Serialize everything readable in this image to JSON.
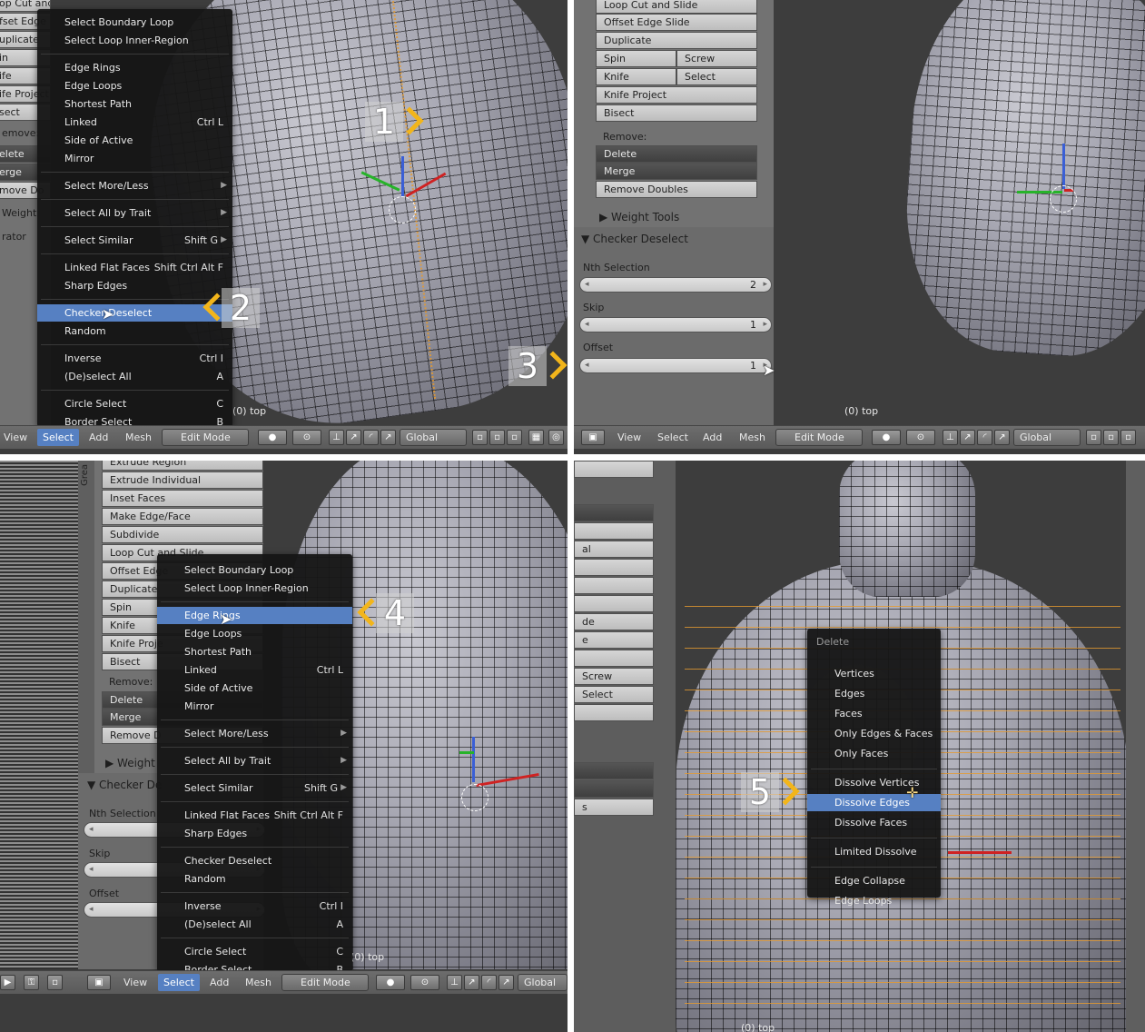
{
  "q1": {
    "left_panel_items": [
      "op Cut and Slide",
      "fset Edge",
      "uplicate",
      "in",
      "ife",
      "ife Project",
      "sect",
      "emove:",
      "elete",
      "erge",
      "move Do",
      "Weight",
      "rator"
    ],
    "menu": [
      {
        "label": "Select Boundary Loop",
        "shortcut": ""
      },
      {
        "label": "Select Loop Inner-Region",
        "shortcut": ""
      },
      {
        "sep": true
      },
      {
        "label": "Edge Rings",
        "shortcut": ""
      },
      {
        "label": "Edge Loops",
        "shortcut": ""
      },
      {
        "label": "Shortest Path",
        "shortcut": ""
      },
      {
        "label": "Linked",
        "shortcut": "Ctrl L"
      },
      {
        "label": "Side of Active",
        "shortcut": ""
      },
      {
        "label": "Mirror",
        "shortcut": ""
      },
      {
        "sep": true
      },
      {
        "label": "Select More/Less",
        "shortcut": "",
        "submenu": true
      },
      {
        "sep": true
      },
      {
        "label": "Select All by Trait",
        "shortcut": "",
        "submenu": true
      },
      {
        "sep": true
      },
      {
        "label": "Select Similar",
        "shortcut": "Shift G",
        "submenu": true
      },
      {
        "sep": true
      },
      {
        "label": "Linked Flat Faces",
        "shortcut": "Shift Ctrl Alt F"
      },
      {
        "label": "Sharp Edges",
        "shortcut": ""
      },
      {
        "sep": true
      },
      {
        "label": "Checker Deselect",
        "shortcut": "",
        "highlight": true
      },
      {
        "label": "Random",
        "shortcut": ""
      },
      {
        "sep": true
      },
      {
        "label": "Inverse",
        "shortcut": "Ctrl I"
      },
      {
        "label": "(De)select All",
        "shortcut": "A"
      },
      {
        "sep": true
      },
      {
        "label": "Circle Select",
        "shortcut": "C"
      },
      {
        "label": "Border Select",
        "shortcut": "B"
      }
    ],
    "view_label": "(0) top",
    "callouts": [
      "1",
      "2",
      "3"
    ],
    "header": {
      "view": "View",
      "select": "Select",
      "add": "Add",
      "mesh": "Mesh",
      "mode": "Edit Mode",
      "orientation": "Global"
    }
  },
  "q2": {
    "tools": [
      "Loop Cut and Slide",
      "Offset Edge Slide",
      "Duplicate"
    ],
    "pairs": [
      [
        "Spin",
        "Screw"
      ],
      [
        "Knife",
        "Select"
      ]
    ],
    "tools2": [
      "Knife Project",
      "Bisect"
    ],
    "remove_label": "Remove:",
    "delete": "Delete",
    "merge": "Merge",
    "remove_doubles": "Remove Doubles",
    "weight_tools": "Weight Tools",
    "panel_title": "Checker Deselect",
    "nth_label": "Nth Selection",
    "nth_value": "2",
    "skip_label": "Skip",
    "skip_value": "1",
    "offset_label": "Offset",
    "offset_value": "1",
    "view_label": "(0) top",
    "header": {
      "view": "View",
      "select": "Select",
      "add": "Add",
      "mesh": "Mesh",
      "mode": "Edit Mode",
      "orientation": "Global"
    }
  },
  "q3": {
    "tools": [
      "Extrude Region",
      "Extrude Individual",
      "Inset Faces",
      "Make Edge/Face",
      "Subdivide",
      "Loop Cut and Slide",
      "Offset Edge",
      "Duplicate",
      "Spin",
      "Knife",
      "Knife Proje",
      "Bisect"
    ],
    "remove_label": "Remove:",
    "delete": "Delete",
    "merge": "Merge",
    "remove_doubles": "Remove D",
    "weight": "Weight",
    "checker": "Checker De",
    "nth_label": "Nth Selection",
    "skip_label": "Skip",
    "offset_label": "Offset",
    "vertical_tab": "Grea",
    "menu": [
      {
        "label": "Select Boundary Loop",
        "shortcut": ""
      },
      {
        "label": "Select Loop Inner-Region",
        "shortcut": ""
      },
      {
        "sep": true
      },
      {
        "label": "Edge Rings",
        "shortcut": "",
        "highlight": true
      },
      {
        "label": "Edge Loops",
        "shortcut": ""
      },
      {
        "label": "Shortest Path",
        "shortcut": ""
      },
      {
        "label": "Linked",
        "shortcut": "Ctrl L"
      },
      {
        "label": "Side of Active",
        "shortcut": ""
      },
      {
        "label": "Mirror",
        "shortcut": ""
      },
      {
        "sep": true
      },
      {
        "label": "Select More/Less",
        "shortcut": "",
        "submenu": true
      },
      {
        "sep": true
      },
      {
        "label": "Select All by Trait",
        "shortcut": "",
        "submenu": true
      },
      {
        "sep": true
      },
      {
        "label": "Select Similar",
        "shortcut": "Shift G",
        "submenu": true
      },
      {
        "sep": true
      },
      {
        "label": "Linked Flat Faces",
        "shortcut": "Shift Ctrl Alt F"
      },
      {
        "label": "Sharp Edges",
        "shortcut": ""
      },
      {
        "sep": true
      },
      {
        "label": "Checker Deselect",
        "shortcut": ""
      },
      {
        "label": "Random",
        "shortcut": ""
      },
      {
        "sep": true
      },
      {
        "label": "Inverse",
        "shortcut": "Ctrl I"
      },
      {
        "label": "(De)select All",
        "shortcut": "A"
      },
      {
        "sep": true
      },
      {
        "label": "Circle Select",
        "shortcut": "C"
      },
      {
        "label": "Border Select",
        "shortcut": "B"
      }
    ],
    "view_label": "(0) top",
    "callout": "4",
    "header": {
      "view": "View",
      "select": "Select",
      "add": "Add",
      "mesh": "Mesh",
      "mode": "Edit Mode",
      "orientation": "Global"
    }
  },
  "q4": {
    "left_fragments": [
      "al",
      "de",
      "e",
      "Screw",
      "Select",
      "s"
    ],
    "menu_title": "Delete",
    "menu": [
      {
        "label": "Vertices"
      },
      {
        "label": "Edges"
      },
      {
        "label": "Faces"
      },
      {
        "label": "Only Edges & Faces"
      },
      {
        "label": "Only Faces"
      },
      {
        "sep": true
      },
      {
        "label": "Dissolve Vertices"
      },
      {
        "label": "Dissolve Edges",
        "highlight": true
      },
      {
        "label": "Dissolve Faces"
      },
      {
        "sep": true
      },
      {
        "label": "Limited Dissolve"
      },
      {
        "sep": true
      },
      {
        "label": "Edge Collapse"
      },
      {
        "label": "Edge Loops"
      }
    ],
    "view_label": "(0) top",
    "callout": "5"
  }
}
